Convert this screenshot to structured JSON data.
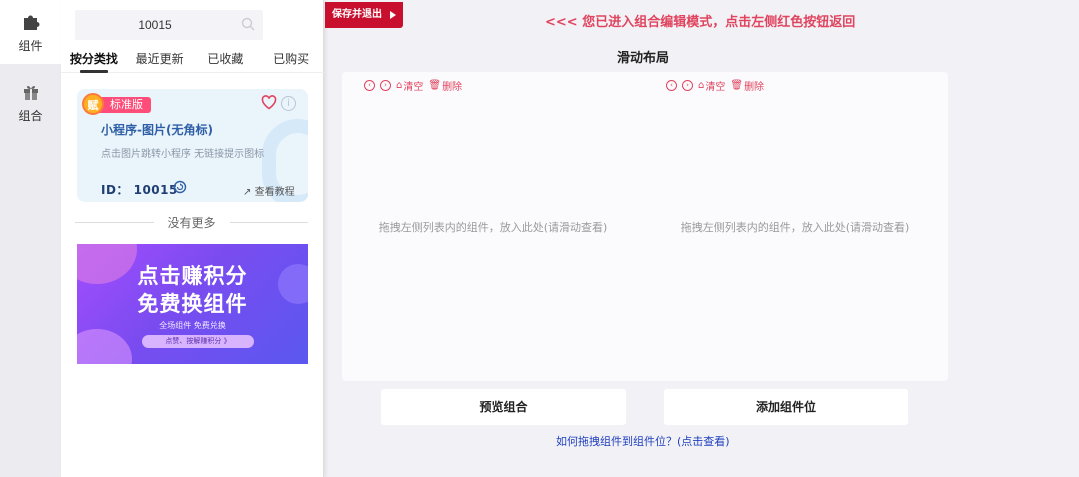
{
  "rail": {
    "items": [
      {
        "label": "组件",
        "icon": "puzzle-icon"
      },
      {
        "label": "组合",
        "icon": "gift-icon"
      }
    ]
  },
  "panel": {
    "search": {
      "value": "10015",
      "placeholder": ""
    },
    "tabs": [
      {
        "label": "按分类找",
        "active": true
      },
      {
        "label": "最近更新",
        "active": false
      },
      {
        "label": "已收藏",
        "active": false
      },
      {
        "label": "已购买",
        "active": false
      }
    ],
    "card": {
      "badge_icon": "赋",
      "badge": "标准版",
      "title": "小程序-图片(无角标)",
      "desc": "点击图片跳转小程序   无链接提示图标",
      "id_text": "ID： 10015",
      "tutorial": "查看教程"
    },
    "no_more": "没有更多",
    "banner": {
      "line1": "点击赚积分",
      "line2": "免费换组件",
      "line3": "全场组件 免费兑换",
      "button": "点赞、按解赚积分 》"
    }
  },
  "main": {
    "save_exit": "保存并退出",
    "notice": "<<< 您已进入组合编辑模式，点击左侧红色按钮返回",
    "layout_title": "滑动布局",
    "slots": [
      {
        "clear": "清空",
        "delete": "删除",
        "hint": "拖拽左侧列表内的组件，放入此处(请滑动查看)"
      },
      {
        "clear": "清空",
        "delete": "删除",
        "hint": "拖拽左侧列表内的组件，放入此处(请滑动查看)"
      }
    ],
    "preview_button": "预览组合",
    "add_slot_button": "添加组件位",
    "help_link": "如何拖拽组件到组件位？(点击查看)"
  },
  "colors": {
    "accent_red": "#c8102e",
    "notice_red": "#e0445f",
    "link_blue": "#1f3fbf",
    "card_title_blue": "#2e5fa6"
  }
}
